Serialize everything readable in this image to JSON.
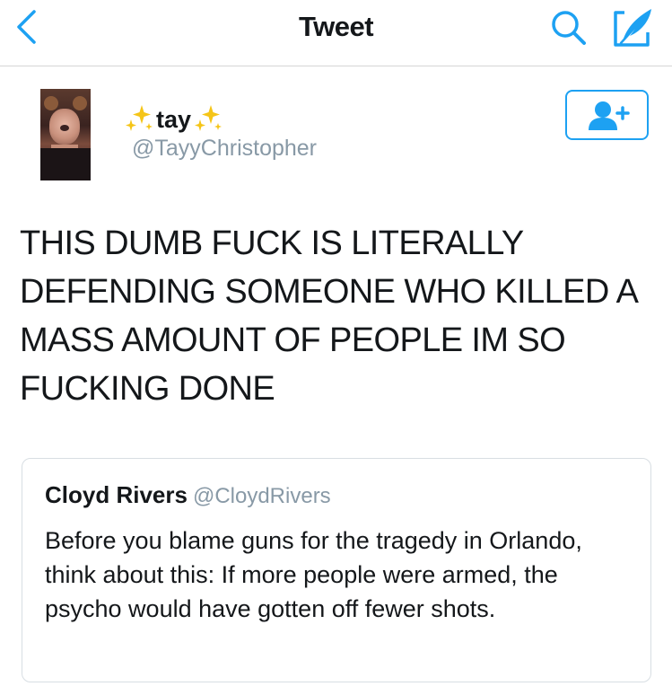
{
  "nav": {
    "title": "Tweet",
    "back_icon": "chevron-left-icon",
    "search_icon": "search-icon",
    "compose_icon": "compose-icon",
    "accent_color": "#1da1f2"
  },
  "tweet": {
    "display_name": "tay",
    "name_decoration_icon": "sparkles-icon",
    "handle": "@TayyChristopher",
    "text": "THIS DUMB FUCK IS LITERALLY DEFENDING SOMEONE WHO KILLED A MASS AMOUNT OF PEOPLE IM SO FUCKING DONE",
    "follow_icon": "add-user-icon"
  },
  "quoted_tweet": {
    "display_name": "Cloyd Rivers",
    "handle": "@CloydRivers",
    "text": "Before you blame guns for the tragedy in Orlando, think about this: If more people were armed, the psycho would have gotten off fewer shots."
  }
}
